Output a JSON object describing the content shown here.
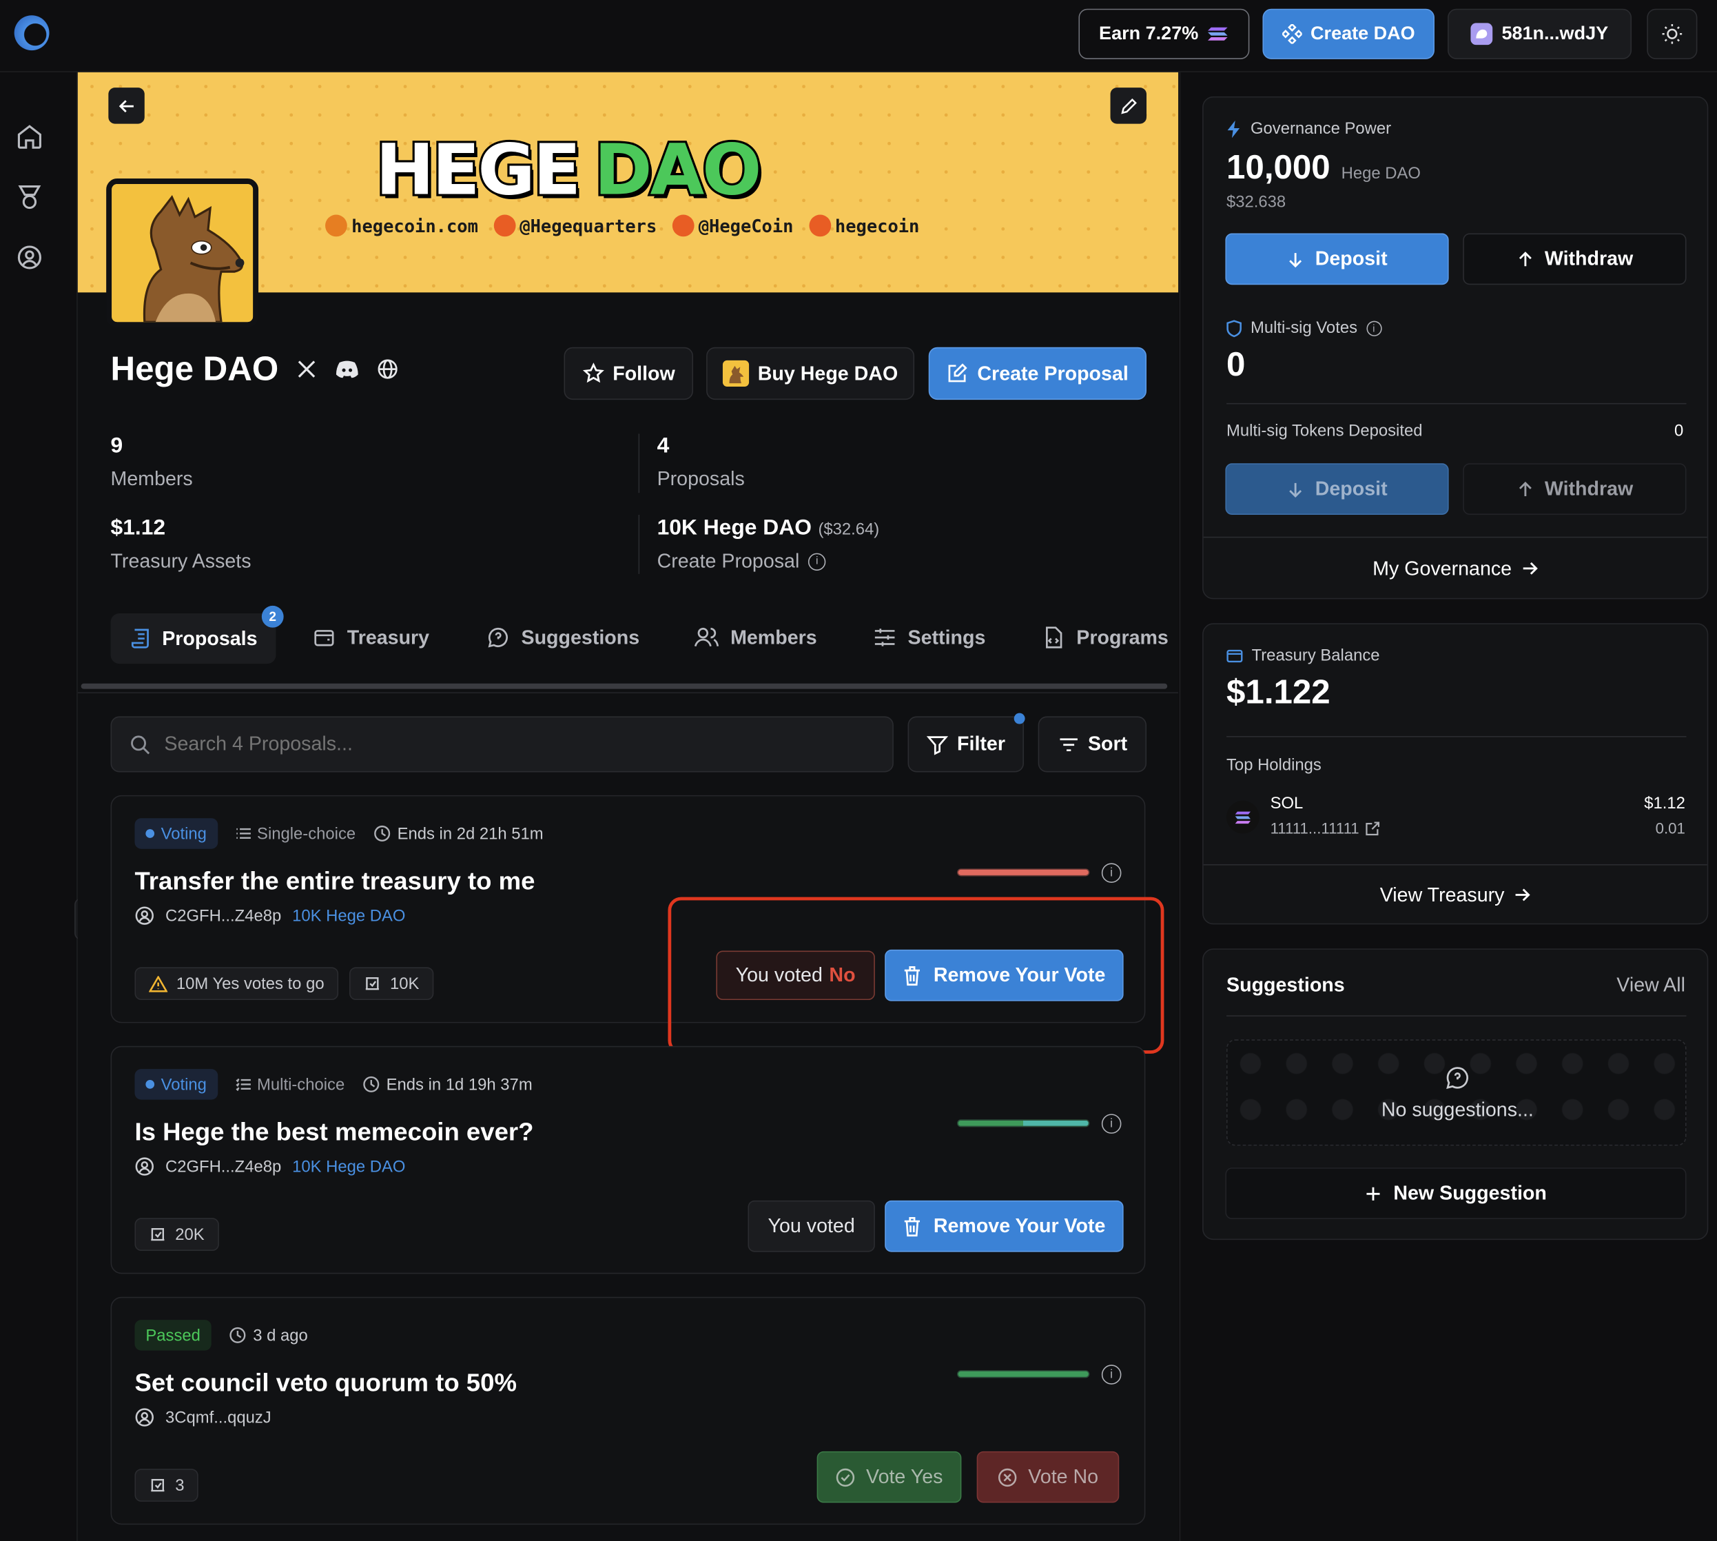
{
  "topbar": {
    "earn_label": "Earn 7.27%",
    "create_dao_label": "Create DAO",
    "wallet_label": "581n...wdJY"
  },
  "banner": {
    "title_part1": "HEGE",
    "title_part2": "DAO",
    "links": [
      "hegecoin.com",
      "@Hegequarters",
      "@HegeCoin",
      "hegecoin"
    ]
  },
  "dao": {
    "name": "Hege DAO",
    "follow_label": "Follow",
    "buy_label": "Buy Hege DAO",
    "create_proposal_label": "Create Proposal",
    "stats": {
      "members_value": "9",
      "members_label": "Members",
      "proposals_value": "4",
      "proposals_label": "Proposals",
      "treasury_value": "$1.12",
      "treasury_label": "Treasury Assets",
      "threshold_value": "10K Hege DAO",
      "threshold_usd": "($32.64)",
      "threshold_label": "Create Proposal"
    }
  },
  "tabs": [
    {
      "label": "Proposals",
      "badge": "2"
    },
    {
      "label": "Treasury"
    },
    {
      "label": "Suggestions"
    },
    {
      "label": "Members"
    },
    {
      "label": "Settings"
    },
    {
      "label": "Programs"
    }
  ],
  "search": {
    "placeholder": "Search 4 Proposals...",
    "filter_label": "Filter",
    "sort_label": "Sort"
  },
  "proposals": [
    {
      "status": "Voting",
      "type": "Single-choice",
      "time": "Ends in 2d 21h 51m",
      "title": "Transfer the entire treasury to me",
      "author": "C2GFH...Z4e8p",
      "token": "10K Hege DAO",
      "chip1": "10M Yes votes to go",
      "chip2": "10K",
      "voted_prefix": "You voted",
      "voted_choice": "No",
      "action_label": "Remove Your Vote"
    },
    {
      "status": "Voting",
      "type": "Multi-choice",
      "time": "Ends in 1d 19h 37m",
      "title": "Is Hege the best memecoin ever?",
      "author": "C2GFH...Z4e8p",
      "token": "10K Hege DAO",
      "chip1": "20K",
      "voted_prefix": "You voted",
      "action_label": "Remove Your Vote"
    },
    {
      "status": "Passed",
      "time": "3 d ago",
      "title": "Set council veto quorum to 50%",
      "author": "3Cqmf...qquzJ",
      "chip1": "3",
      "vote_yes_label": "Vote Yes",
      "vote_no_label": "Vote No"
    }
  ],
  "governance": {
    "title": "Governance Power",
    "amount": "10,000",
    "unit": "Hege DAO",
    "usd": "$32.638",
    "deposit_label": "Deposit",
    "withdraw_label": "Withdraw",
    "multisig_title": "Multi-sig Votes",
    "multisig_value": "0",
    "multisig_tokens_label": "Multi-sig Tokens Deposited",
    "multisig_tokens_value": "0",
    "my_governance_label": "My Governance"
  },
  "treasury": {
    "title": "Treasury Balance",
    "amount": "$1.122",
    "holdings_label": "Top Holdings",
    "holding_symbol": "SOL",
    "holding_address": "11111...11111",
    "holding_value": "$1.12",
    "holding_amount": "0.01",
    "view_label": "View Treasury"
  },
  "suggestions": {
    "title": "Suggestions",
    "view_all": "View All",
    "empty": "No suggestions...",
    "new_label": "New Suggestion"
  },
  "colors": {
    "accent": "#3b82d6",
    "banner": "#f6c85a",
    "highlight": "#e0371f",
    "vote_yes": "#2e6b3a",
    "vote_no": "#6e2a2a"
  }
}
